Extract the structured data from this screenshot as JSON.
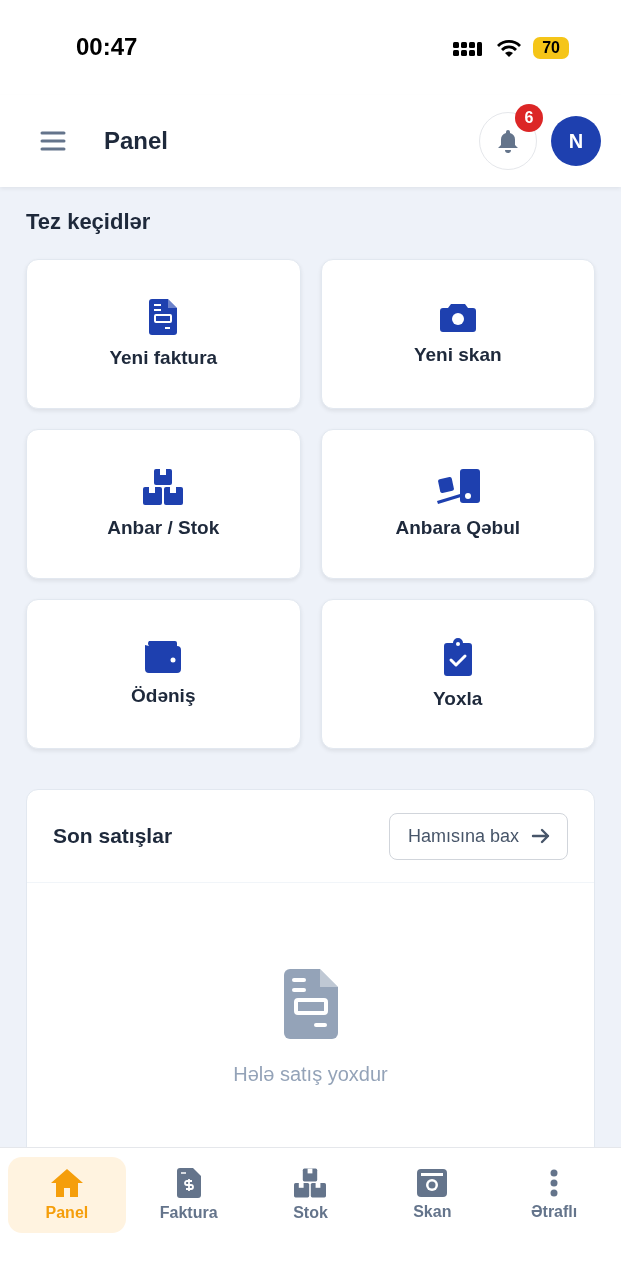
{
  "status_bar": {
    "time": "00:47",
    "battery": "70"
  },
  "header": {
    "title": "Panel",
    "notifications_badge": "6",
    "avatar": "N"
  },
  "quick_links": {
    "title": "Tez keçidlər",
    "items": [
      {
        "label": "Yeni faktura"
      },
      {
        "label": "Yeni skan"
      },
      {
        "label": "Anbar / Stok"
      },
      {
        "label": "Anbara Qəbul"
      },
      {
        "label": "Ödəniş"
      },
      {
        "label": "Yoxla"
      }
    ]
  },
  "recent_sales": {
    "title": "Son satışlar",
    "view_all": "Hamısına bax",
    "empty_text": "Hələ satış yoxdur"
  },
  "bottom_nav": [
    {
      "label": "Panel",
      "selected": true
    },
    {
      "label": "Faktura",
      "selected": false
    },
    {
      "label": "Stok",
      "selected": false
    },
    {
      "label": "Skan",
      "selected": false
    },
    {
      "label": "Ətraflı",
      "selected": false
    }
  ]
}
